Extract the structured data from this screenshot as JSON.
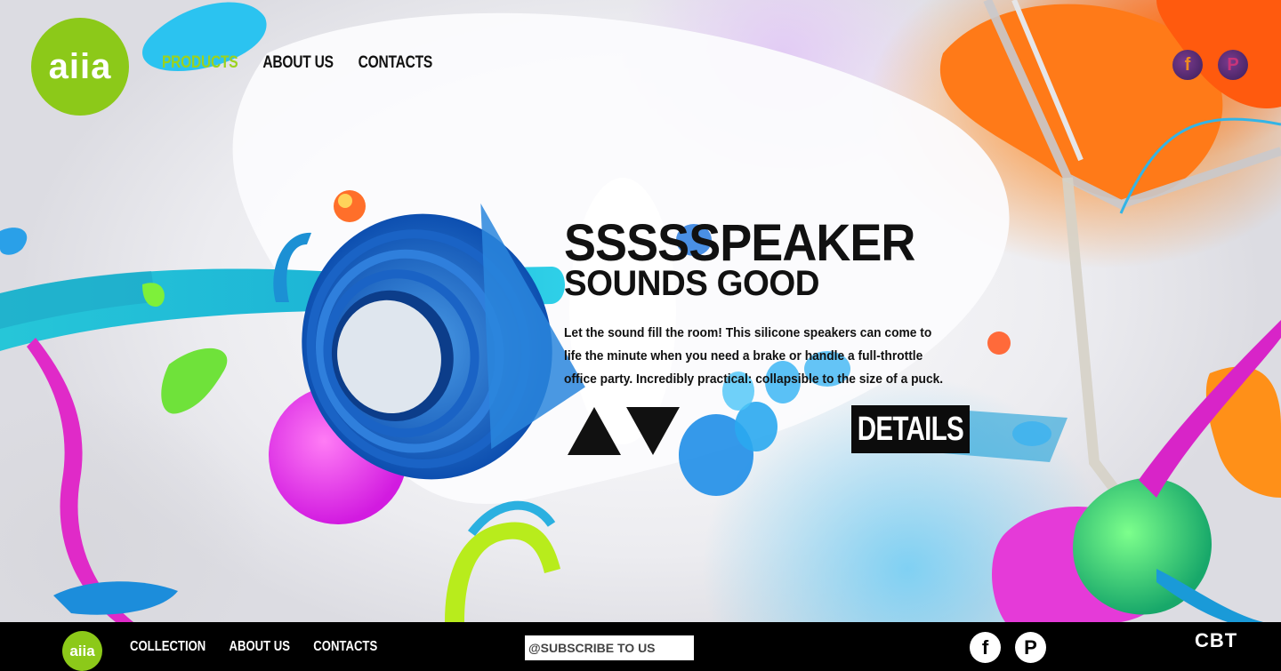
{
  "brand": {
    "logo_text": "aiia",
    "green": "#8cc919"
  },
  "nav": {
    "items": [
      {
        "label": "PRODUCTS",
        "active": true
      },
      {
        "label": "ABOUT US",
        "active": false
      },
      {
        "label": "CONTACTS",
        "active": false
      }
    ]
  },
  "social_top": {
    "facebook_glyph": "f",
    "pinterest_glyph": "P"
  },
  "hero": {
    "title": "SSSSSPEAKER",
    "subtitle": "SOUNDS GOOD",
    "description": "Let the sound fill the room! This silicone speakers can come to life the minute when you need a brake or handle a full-throttle office party. Incredibly practical: collapsible to the size of a puck.",
    "details_label": "DETAILS",
    "prev_icon": "triangle-up-icon",
    "next_icon": "triangle-down-icon"
  },
  "footer": {
    "logo_text": "aiia",
    "links": [
      "COLLECTION",
      "ABOUT US",
      "CONTACTS"
    ],
    "subscribe_placeholder": "@SUBSCRIBE TO US",
    "facebook_glyph": "f",
    "pinterest_glyph": "P",
    "credit": "CBT"
  }
}
